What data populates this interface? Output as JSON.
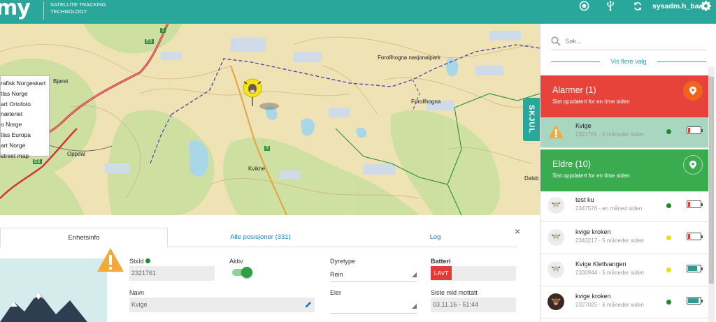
{
  "header": {
    "logo": "my",
    "tagline_1": "SATELLITE TRACKING",
    "tagline_2": "TECHNOLOGY",
    "username": "sysadm.h_baar",
    "icons": [
      "target-icon",
      "usb-icon",
      "refresh-icon",
      "gear-icon"
    ]
  },
  "map": {
    "layers": [
      "rafisk Norgeskart",
      "tlas Norge",
      "art Ortofoto",
      "næteriet",
      "o Norge",
      "tlas Europa",
      "art Norge",
      "street map"
    ],
    "places": {
      "bjoret": "Bjøret",
      "forollhogna_np": "Forollhogna nasjonalpark",
      "forollhogna": "Forollhogna",
      "oppdal": "Oppdal",
      "kvikne": "Kvikne",
      "dalsb": "Dalsb",
      "e6a": "E6",
      "e6b": "E6",
      "r3": "3",
      "r1": "1"
    },
    "hide_tab": "SKJUL"
  },
  "panel": {
    "tabs": [
      "Enhetsinfo",
      "Alle posisjoner (331)",
      "Log"
    ],
    "close": "×",
    "labels": {
      "stxid": "StxId",
      "aktiv": "Aktiv",
      "dyretype": "Dyretype",
      "batteri": "Batteri",
      "navn": "Navn",
      "eier": "Eier",
      "siste": "Siste mld mottatt"
    },
    "values": {
      "stxid": "2321761",
      "dyretype": "Rein",
      "batteri": "LAVT",
      "navn": "Kvige",
      "eier": "",
      "siste": "03.11.16 - 51:44"
    },
    "aktiv": true
  },
  "sidebar": {
    "search_placeholder": "Søk...",
    "more_options": "Vis flere valg",
    "alarm_group": {
      "title": "Alarmer (1)",
      "subtitle": "Sist oppdatert for en time siden",
      "color": "#e8433a",
      "pin_color": "#f0641e"
    },
    "alarm_item": {
      "name": "Kvige",
      "sub": "2321761 · 6 måneder siden",
      "dot": "#1e8c2a",
      "battery": 0.2,
      "battery_color": "#e53935",
      "bg": "#a8d6c1"
    },
    "old_group": {
      "title": "Eldre (10)",
      "subtitle": "Sist oppdatert for en time siden",
      "color": "#3aab4e",
      "pin_color": "#3aab4e"
    },
    "items": [
      {
        "name": "test ku",
        "sub": "2347576 · en måned siden",
        "dot": "#1e8c2a",
        "battery": 0.2,
        "battery_color": "#e53935",
        "avatar": "cow-white"
      },
      {
        "name": "kvige kroken",
        "sub": "2343217 · 5 måneder siden",
        "dot": "#e6e022",
        "battery": 0.2,
        "battery_color": "#e53935",
        "avatar": "cow-white"
      },
      {
        "name": "Kvige Klettvangen",
        "sub": "2330944 · 5 måneder siden",
        "dot": "#e6e022",
        "battery": 0.75,
        "battery_color": "#2a9d8f",
        "avatar": "cow-white"
      },
      {
        "name": "kvige kroken",
        "sub": "2327025 · 6 måneder siden",
        "dot": "#1e8c2a",
        "battery": 0.9,
        "battery_color": "#2a9d8f",
        "avatar": "cow-dark"
      }
    ]
  },
  "colors": {
    "brand": "#2aa79b",
    "link": "#1e7fd0"
  }
}
